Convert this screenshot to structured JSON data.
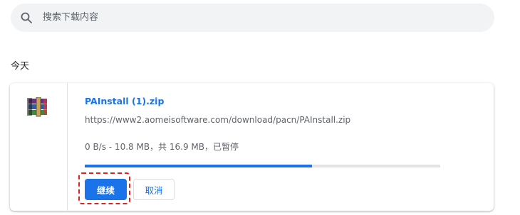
{
  "search": {
    "placeholder": "搜索下载内容",
    "icon": "search-icon"
  },
  "section": {
    "label": "今天"
  },
  "download": {
    "file_name": "PAInstall (1).zip",
    "url": "https://www2.aomeisoftware.com/download/pacn/PAInstall.zip",
    "status": "0 B/s - 10.8 MB，共 16.9 MB，已暂停",
    "progress_fraction": 0.64,
    "file_icon": "winrar-archive-icon",
    "resume_label": "继续",
    "cancel_label": "取消"
  },
  "colors": {
    "accent": "#1a73e8",
    "highlight": "#e0211d",
    "search_bg": "#f1f3f4"
  }
}
